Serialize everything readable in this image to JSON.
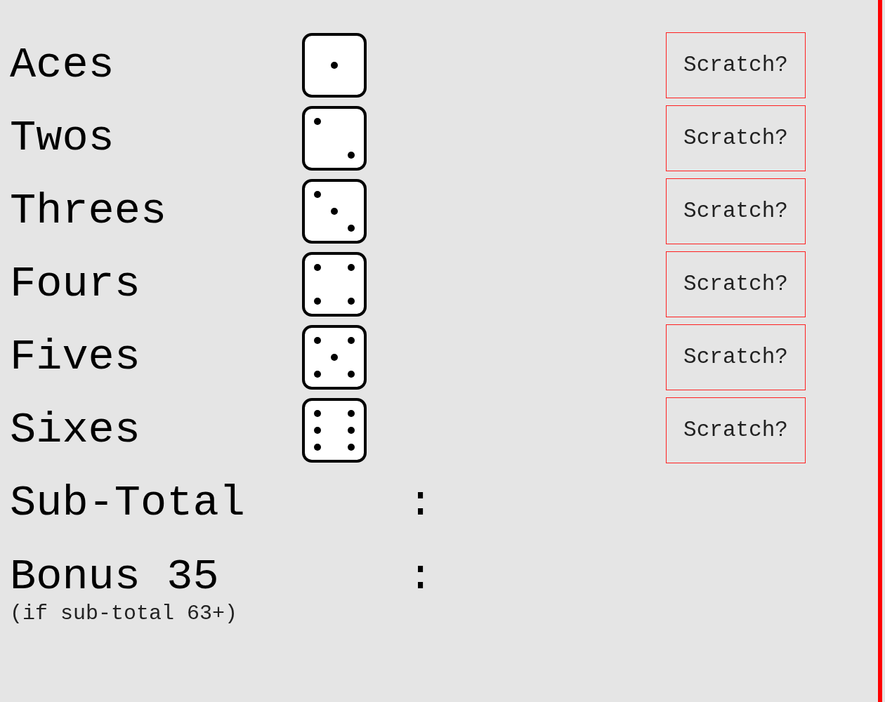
{
  "categories": [
    {
      "label": "Aces",
      "kind": "one",
      "button": "Scratch?"
    },
    {
      "label": "Twos",
      "kind": "two",
      "button": "Scratch?"
    },
    {
      "label": "Threes",
      "kind": "three",
      "button": "Scratch?"
    },
    {
      "label": "Fours",
      "kind": "four",
      "button": "Scratch?"
    },
    {
      "label": "Fives",
      "kind": "five",
      "button": "Scratch?"
    },
    {
      "label": "Sixes",
      "kind": "six",
      "button": "Scratch?"
    }
  ],
  "totals": [
    {
      "label": "Sub-Total",
      "separator": ":"
    },
    {
      "label": "Bonus 35",
      "separator": ":",
      "note": "(if sub-total 63+)"
    }
  ]
}
